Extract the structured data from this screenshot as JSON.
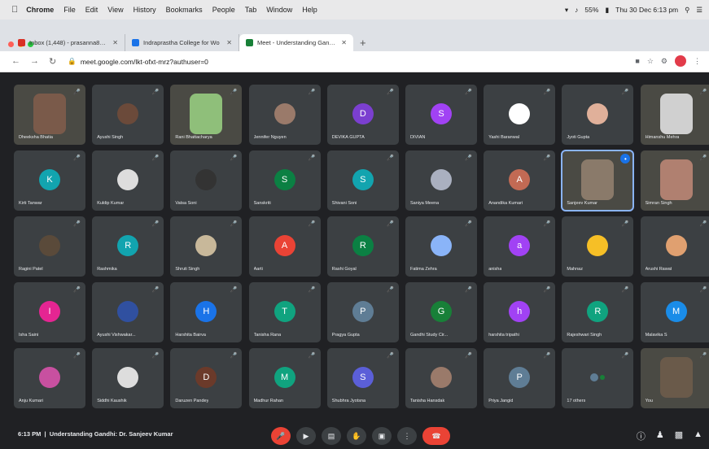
{
  "menubar": {
    "apple": "",
    "items": [
      "Chrome",
      "File",
      "Edit",
      "View",
      "History",
      "Bookmarks",
      "People",
      "Tab",
      "Window",
      "Help"
    ],
    "battery": "55%",
    "clock": "Thu 30 Dec 6:13 pm"
  },
  "tabs": [
    {
      "title": "Inbox (1,448) - prasanna8@g",
      "color": "#d93025",
      "active": false
    },
    {
      "title": "Indraprastha College for Wo",
      "color": "#1a73e8",
      "active": false
    },
    {
      "title": "Meet - Understanding Gandhi",
      "color": "#188038",
      "active": true
    }
  ],
  "address": {
    "url": "meet.google.com/lkt-ofxt-mrz?authuser=0"
  },
  "tiles": [
    {
      "name": "Dheeksha Bhatia",
      "initial": "",
      "color": "#7a5a4a",
      "video": true
    },
    {
      "name": "Ayushi Singh",
      "initial": "",
      "color": "#6b4a3a",
      "photo": true
    },
    {
      "name": "Rani Bhattacharya",
      "initial": "",
      "color": "#8fbf7a",
      "video": true
    },
    {
      "name": "Jennifer Nguyen",
      "initial": "",
      "color": "#9a7a6a",
      "photo": true
    },
    {
      "name": "DEVIKA GUPTA",
      "initial": "D",
      "color": "#7b3fd0"
    },
    {
      "name": "DIVIAN",
      "initial": "S",
      "color": "#a142f4"
    },
    {
      "name": "Yashi Baranwal",
      "initial": "",
      "color": "#ffffff",
      "photo": true
    },
    {
      "name": "Jyoti Gupta",
      "initial": "",
      "color": "#e0b09a",
      "photo": true
    },
    {
      "name": "Himanshu Mehra",
      "initial": "",
      "color": "#d0d0d0",
      "video": true
    },
    {
      "name": "Kirti Tanwar",
      "initial": "K",
      "color": "#12a4af"
    },
    {
      "name": "Kuldip Kumar",
      "initial": "",
      "color": "#dddddd",
      "photo": true
    },
    {
      "name": "Vatsa Soni",
      "initial": "",
      "color": "#333333",
      "photo": true
    },
    {
      "name": "Sanskriti",
      "initial": "S",
      "color": "#0b8043"
    },
    {
      "name": "Shivani Soni",
      "initial": "S",
      "color": "#12a4af"
    },
    {
      "name": "Saniya Meena",
      "initial": "",
      "color": "#aab0c0",
      "photo": true
    },
    {
      "name": "Anandika Kumari",
      "initial": "A",
      "color": "#c26a54"
    },
    {
      "name": "Sanjeev Kumar",
      "initial": "",
      "color": "#8a7a6a",
      "video": true,
      "speaking": true
    },
    {
      "name": "Simran Singh",
      "initial": "",
      "color": "#b08070",
      "video": true
    },
    {
      "name": "Ragini Patel",
      "initial": "",
      "color": "#5a4a3a",
      "photo": true
    },
    {
      "name": "Rashmika",
      "initial": "R",
      "color": "#12a4af"
    },
    {
      "name": "Shruti Singh",
      "initial": "",
      "color": "#c8b89a",
      "photo": true
    },
    {
      "name": "Aarti",
      "initial": "A",
      "color": "#ea4335"
    },
    {
      "name": "Rashi Goyal",
      "initial": "R",
      "color": "#0b8043"
    },
    {
      "name": "Fatima Zehra",
      "initial": "",
      "color": "#8ab4f8",
      "photo": true
    },
    {
      "name": "anisha",
      "initial": "a",
      "color": "#a142f4"
    },
    {
      "name": "Mahnaz",
      "initial": "",
      "color": "#f6bf26",
      "photo": true
    },
    {
      "name": "Arushi Rawat",
      "initial": "",
      "color": "#e0a070",
      "photo": true
    },
    {
      "name": "Isha Saini",
      "initial": "I",
      "color": "#e52592"
    },
    {
      "name": "Ayushi Vishwakar...",
      "initial": "",
      "color": "#3050a0",
      "photo": true
    },
    {
      "name": "Harshita Bairva",
      "initial": "H",
      "color": "#1a73e8"
    },
    {
      "name": "Tanisha Rana",
      "initial": "T",
      "color": "#10a37f"
    },
    {
      "name": "Pragya Gupta",
      "initial": "P",
      "color": "#5f7d95"
    },
    {
      "name": "Gandhi Study Cir...",
      "initial": "G",
      "color": "#188038"
    },
    {
      "name": "harshita tripathi",
      "initial": "h",
      "color": "#a142f4"
    },
    {
      "name": "Rajeshwari Singh",
      "initial": "R",
      "color": "#10a37f"
    },
    {
      "name": "Malavika S",
      "initial": "M",
      "color": "#1a8ce8"
    },
    {
      "name": "Anju Kumari",
      "initial": "",
      "color": "#c850a0",
      "photo": true
    },
    {
      "name": "Siddhi Kaushik",
      "initial": "",
      "color": "#ddd",
      "photo": true
    },
    {
      "name": "Daruzen Pandey",
      "initial": "D",
      "color": "#6b3a2a"
    },
    {
      "name": "Madhur Rahan",
      "initial": "M",
      "color": "#10a37f"
    },
    {
      "name": "Shubhra Jyotsna",
      "initial": "S",
      "color": "#5b5fd8"
    },
    {
      "name": "Tanisha Hansdak",
      "initial": "",
      "color": "#9a7a6a",
      "photo": true
    },
    {
      "name": "Priya Jangid",
      "initial": "P",
      "color": "#5f7d95"
    },
    {
      "name": "17 others",
      "initial": "",
      "color": "#3c4043",
      "others": true
    },
    {
      "name": "You",
      "initial": "",
      "color": "#6a5a4a",
      "video": true
    }
  ],
  "bottom": {
    "time": "6:13 PM",
    "title": "Understanding Gandhi: Dr. Sanjeev Kumar",
    "controls": [
      "mic-off",
      "camera",
      "captions",
      "raise-hand",
      "present",
      "more",
      "end-call"
    ]
  }
}
